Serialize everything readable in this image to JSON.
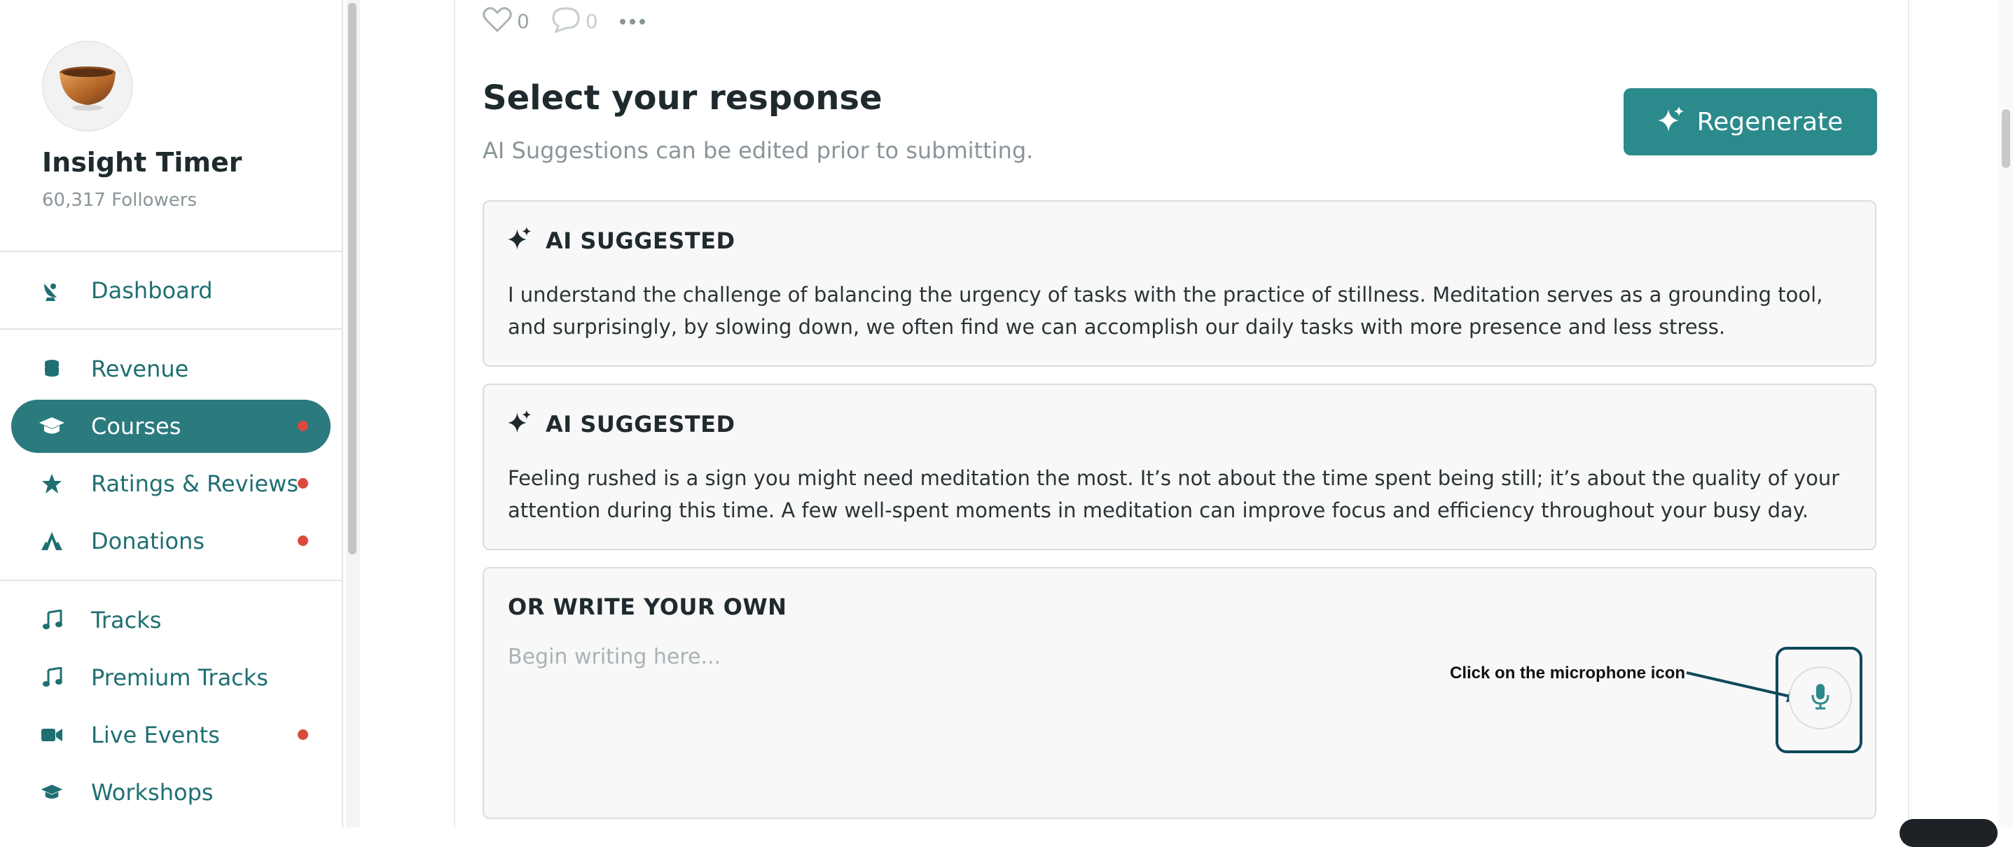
{
  "sidebar": {
    "profile": {
      "name": "Insight Timer",
      "followers": "60,317 Followers"
    },
    "nav": [
      {
        "label": "Dashboard",
        "icon": "satellite-dish-icon",
        "active": false,
        "dot": false
      },
      {
        "label": "Revenue",
        "icon": "coins-icon",
        "active": false,
        "dot": false
      },
      {
        "label": "Courses",
        "icon": "graduation-cap-icon",
        "active": true,
        "dot": true
      },
      {
        "label": "Ratings & Reviews",
        "icon": "star-icon",
        "active": false,
        "dot": true
      },
      {
        "label": "Donations",
        "icon": "donation-hands-icon",
        "active": false,
        "dot": true
      },
      {
        "label": "Tracks",
        "icon": "music-note-icon",
        "active": false,
        "dot": false
      },
      {
        "label": "Premium Tracks",
        "icon": "music-note-icon",
        "active": false,
        "dot": false
      },
      {
        "label": "Live Events",
        "icon": "video-camera-icon",
        "active": false,
        "dot": true
      },
      {
        "label": "Workshops",
        "icon": "graduation-cap-icon",
        "active": false,
        "dot": false
      }
    ]
  },
  "reactions": {
    "likes": "0",
    "comments": "0"
  },
  "response": {
    "heading": "Select your response",
    "subheading": "AI Suggestions can be edited prior to submitting.",
    "regenerate_label": "Regenerate",
    "suggestions": [
      {
        "title": "AI SUGGESTED",
        "text": "I understand the challenge of balancing the urgency of tasks with the practice of stillness. Meditation serves as a grounding tool, and surprisingly, by slowing down, we often find we can accomplish our daily tasks with more presence and less stress."
      },
      {
        "title": "AI SUGGESTED",
        "text": "Feeling rushed is a sign you might need meditation the most. It’s not about the time spent being still; it’s about the quality of your attention during this time. A few well-spent moments in meditation can improve focus and efficiency throughout your busy day."
      }
    ],
    "write_own": {
      "title": "OR WRITE YOUR OWN",
      "placeholder": "Begin writing here..."
    }
  },
  "annotation": {
    "text": "Click on the microphone icon"
  },
  "colors": {
    "accent": "#2b7a7e",
    "button": "#2b8a8c",
    "notification_dot": "#d94a3d",
    "annotation_frame": "#0f4a5a"
  }
}
